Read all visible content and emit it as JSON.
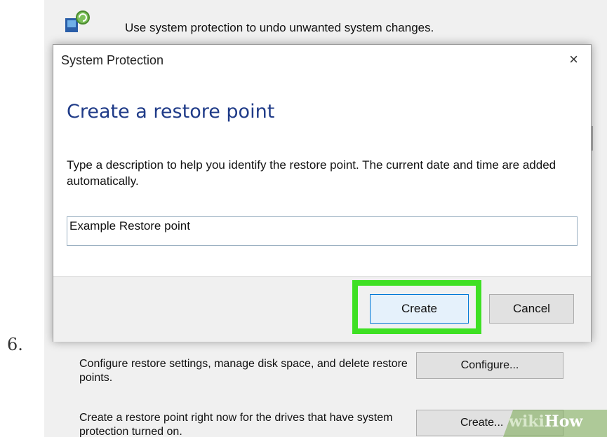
{
  "step_number": "6.",
  "background_window": {
    "top_text": "Use system protection to undo unwanted system changes.",
    "configure_text": "Configure restore settings, manage disk space, and delete restore points.",
    "configure_button": "Configure...",
    "create_text": "Create a restore point right now for the drives that have system protection turned on.",
    "create_button": "Create..."
  },
  "dialog": {
    "title": "System Protection",
    "close": "×",
    "heading": "Create a restore point",
    "description": "Type a description to help you identify the restore point. The current date and time are added automatically.",
    "input_value": "Example Restore point",
    "create_button": "Create",
    "cancel_button": "Cancel",
    "highlight_color": "#3ee023"
  },
  "watermark": {
    "wiki": "wiki",
    "how": "How"
  }
}
